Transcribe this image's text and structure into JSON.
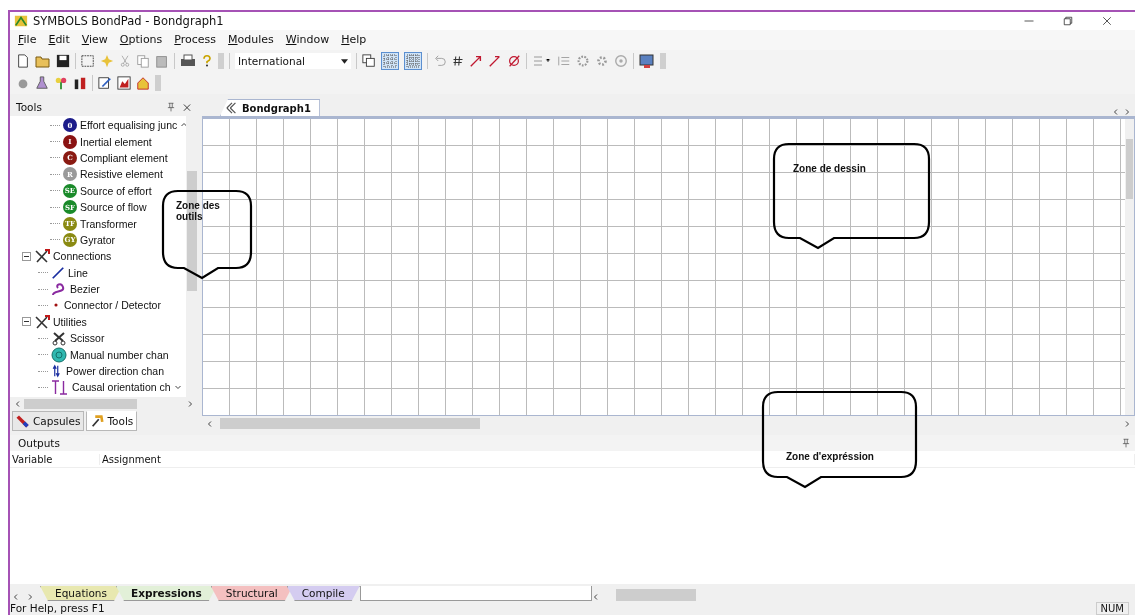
{
  "window": {
    "title": "SYMBOLS BondPad - Bondgraph1"
  },
  "menu": [
    {
      "label": "File"
    },
    {
      "label": "Edit"
    },
    {
      "label": "View"
    },
    {
      "label": "Options"
    },
    {
      "label": "Process"
    },
    {
      "label": "Modules"
    },
    {
      "label": "Window"
    },
    {
      "label": "Help"
    }
  ],
  "toolbar": {
    "language": "International",
    "toggles": [
      {
        "selected": true
      },
      {
        "selected": true
      }
    ]
  },
  "tools_panel": {
    "title": "Tools",
    "tree": [
      {
        "children": [
          {
            "label": "Effort equalising junc",
            "badge": "0",
            "color": "#1c1c8a"
          },
          {
            "label": "Inertial element",
            "badge": "I",
            "color": "#8a1212"
          },
          {
            "label": "Compliant element",
            "badge": "C",
            "color": "#8a1a12"
          },
          {
            "label": "Resistive element",
            "badge": "R",
            "color": "#9a9a9a"
          },
          {
            "label": "Source of effort",
            "badge": "SE",
            "color": "#1a8a2a"
          },
          {
            "label": "Source of flow",
            "badge": "SF",
            "color": "#1a8a2a"
          },
          {
            "label": "Transformer",
            "badge": "TF",
            "color": "#8a8a12"
          },
          {
            "label": "Gyrator",
            "badge": "GY",
            "color": "#8a8a12"
          }
        ]
      },
      {
        "label": "Connections",
        "expanded": true,
        "children": [
          {
            "label": "Line",
            "kind": "line"
          },
          {
            "label": "Bezier",
            "kind": "bezier"
          },
          {
            "label": "Connector / Detector",
            "kind": "dot"
          }
        ]
      },
      {
        "label": "Utilities",
        "expanded": true,
        "children": [
          {
            "label": "Scissor",
            "kind": "scissor"
          },
          {
            "label": "Manual number chan",
            "kind": "number"
          },
          {
            "label": "Power direction chan",
            "kind": "power"
          },
          {
            "label": "Causal orientation ch",
            "kind": "causal"
          }
        ]
      }
    ],
    "tabs": [
      {
        "label": "Capsules",
        "selected": false
      },
      {
        "label": "Tools",
        "selected": true
      }
    ]
  },
  "document": {
    "tab": "Bondgraph1"
  },
  "outputs": {
    "title": "Outputs",
    "columns": [
      "Variable",
      "Assignment"
    ],
    "tabs": [
      {
        "label": "Equations",
        "color": "#e8e8b0",
        "selected": false
      },
      {
        "label": "Expressions",
        "color": "#e2f0d8",
        "selected": true
      },
      {
        "label": "Structural",
        "color": "#f4c0c0",
        "selected": false
      },
      {
        "label": "Compile",
        "color": "#d4ccf0",
        "selected": false
      }
    ]
  },
  "callouts": [
    {
      "text": "Zone des outils"
    },
    {
      "text": "Zone de dessin"
    },
    {
      "text": "Zone d'expréssion"
    }
  ],
  "status_bar": {
    "message": "For Help, press F1",
    "indicator": "NUM"
  }
}
